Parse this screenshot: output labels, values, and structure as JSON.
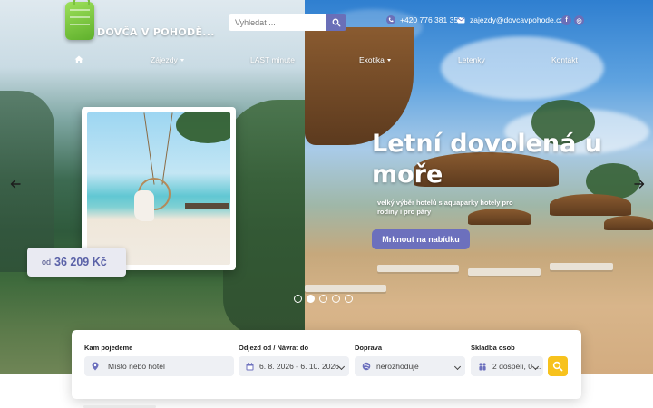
{
  "brand": {
    "name": "DOVČA V POHODĚ..."
  },
  "search": {
    "placeholder": "Vyhledat ..."
  },
  "contact": {
    "phone": "+420 776 381 351",
    "email": "zajezdy@dovcavpohode.cz"
  },
  "social": {
    "facebook": "f",
    "instagram": "◎"
  },
  "nav": {
    "items": [
      {
        "label": "",
        "icon": "home-icon"
      },
      {
        "label": "Zájezdy",
        "dropdown": true
      },
      {
        "label": "LAST minute",
        "dropdown": false
      },
      {
        "label": "Exotika",
        "dropdown": true
      },
      {
        "label": "Letenky",
        "dropdown": false
      },
      {
        "label": "Kontakt",
        "dropdown": false
      }
    ]
  },
  "slide": {
    "title": "Letní dovolená u moře",
    "subtitle": "velký výběr hotelů s aquaparky hotely pro rodiny i pro páry",
    "cta": "Mrknout na nabídku",
    "price_prefix": "od",
    "price_value": "36 209 Kč",
    "dots_count": 5,
    "active_dot": 2
  },
  "booking": {
    "destination": {
      "label": "Kam pojedeme",
      "placeholder": "Místo nebo hotel"
    },
    "dates": {
      "label": "Odjezd od / Návrat do",
      "value": "6. 8. 2026 - 6. 10. 2026"
    },
    "transport": {
      "label": "Doprava",
      "value": "nerozhoduje"
    },
    "persons": {
      "label": "Skladba osob",
      "value": "2 dospělí, 0 ..."
    }
  },
  "colors": {
    "accent": "#6c70bd",
    "search_button": "#f7c21d",
    "price_text": "#5b62a8"
  }
}
